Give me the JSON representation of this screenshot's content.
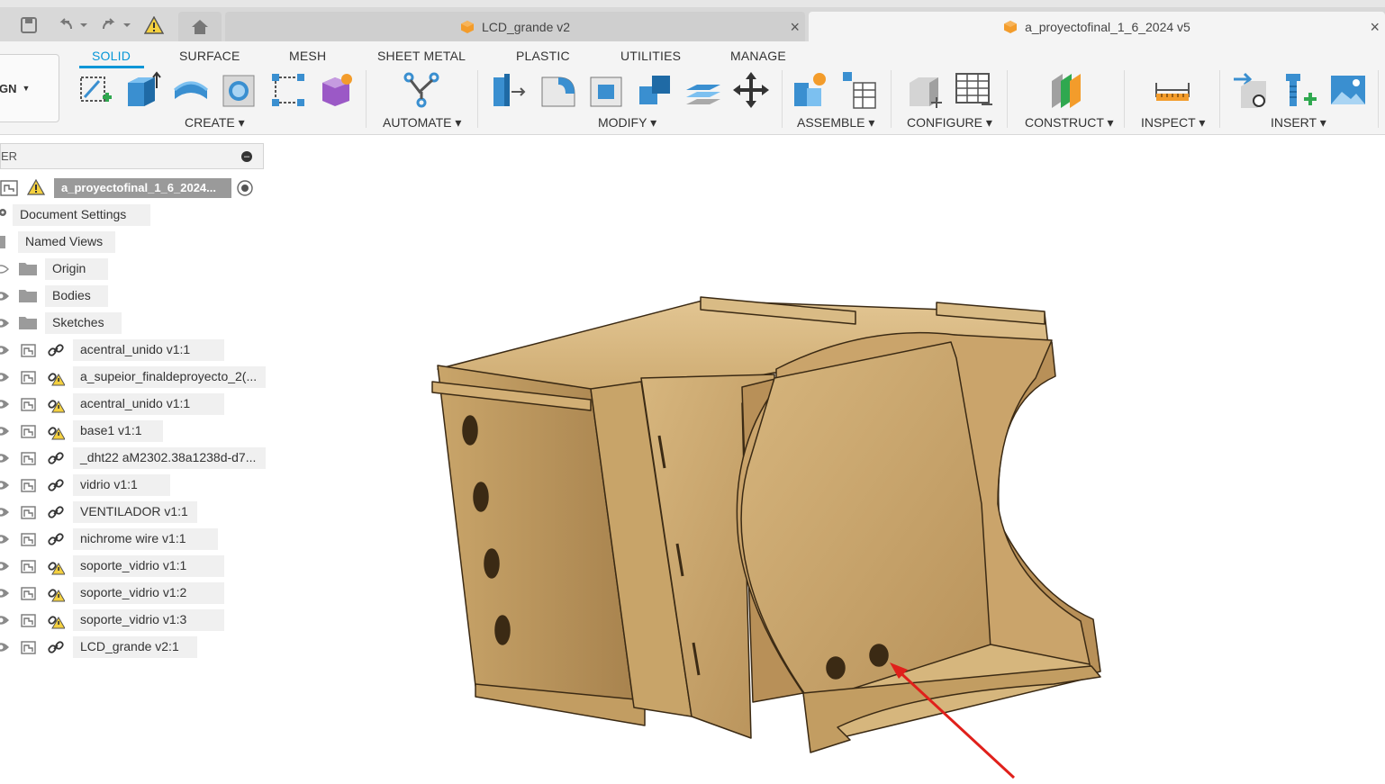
{
  "window": {
    "tabs": [
      {
        "label": "LCD_grande v2",
        "active": false
      },
      {
        "label": "a_proyectofinal_1_6_2024 v5",
        "active": true
      }
    ],
    "close_glyph": "×"
  },
  "workspace_switcher": {
    "label": "GN"
  },
  "ribbon": {
    "tabs": [
      "SOLID",
      "SURFACE",
      "MESH",
      "SHEET METAL",
      "PLASTIC",
      "UTILITIES",
      "MANAGE"
    ],
    "active_tab": "SOLID",
    "groups": [
      "CREATE ▾",
      "AUTOMATE ▾",
      "MODIFY ▾",
      "ASSEMBLE ▾",
      "CONFIGURE ▾",
      "CONSTRUCT ▾",
      "INSPECT ▾",
      "INSERT ▾"
    ]
  },
  "browser": {
    "header": "ER",
    "root": "a_proyectofinal_1_6_2024...",
    "items": [
      {
        "label": "Document Settings",
        "icon": "gear-icon"
      },
      {
        "label": "Named Views",
        "icon": "folder-icon"
      },
      {
        "label": "Origin",
        "icon": "folder-icon"
      },
      {
        "label": "Bodies",
        "icon": "folder-icon"
      },
      {
        "label": "Sketches",
        "icon": "folder-icon"
      },
      {
        "label": "acentral_unido v1:1",
        "icon": "link-icon"
      },
      {
        "label": "a_supeior_finaldeproyecto_2(...",
        "icon": "link-warning-icon"
      },
      {
        "label": "acentral_unido v1:1",
        "icon": "link-warning-icon"
      },
      {
        "label": "base1 v1:1",
        "icon": "link-warning-icon"
      },
      {
        "label": "_dht22 aM2302.38a1238d-d7...",
        "icon": "link-icon"
      },
      {
        "label": "vidrio v1:1",
        "icon": "link-icon"
      },
      {
        "label": "VENTILADOR v1:1",
        "icon": "link-icon"
      },
      {
        "label": "nichrome wire v1:1",
        "icon": "link-icon"
      },
      {
        "label": "soporte_vidrio v1:1",
        "icon": "link-warning-icon"
      },
      {
        "label": "soporte_vidrio v1:2",
        "icon": "link-warning-icon"
      },
      {
        "label": "soporte_vidrio v1:3",
        "icon": "link-warning-icon"
      },
      {
        "label": "LCD_grande v2:1",
        "icon": "link-icon"
      }
    ]
  },
  "colors": {
    "accent": "#0696d7",
    "wood": "#c9a56a",
    "arrow": "#e0201b"
  }
}
